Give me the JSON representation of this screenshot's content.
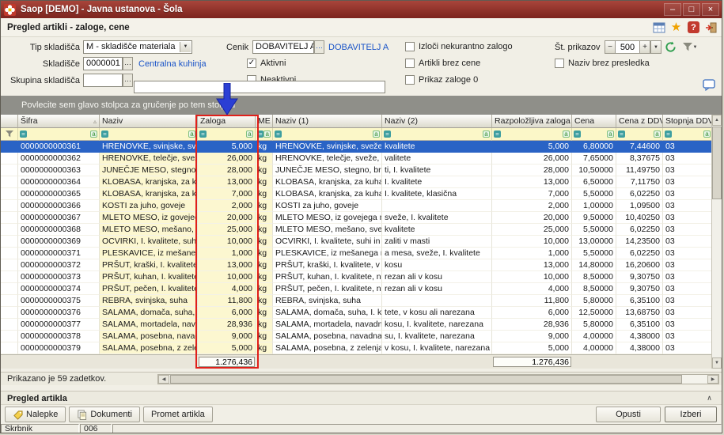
{
  "title_bar": {
    "title": "Saop  [DEMO] - Javna ustanova - Šola"
  },
  "icons": {
    "minimize": "–",
    "maximize": "□",
    "close": "×",
    "star": "★",
    "help": "?",
    "sort_asc": "▵",
    "check": "✓",
    "up": "▲",
    "down": "▼",
    "left": "◀",
    "right": "▶",
    "collapse": "∧",
    "caret": "▼",
    "minus": "−",
    "plus": "+",
    "ellipsis": "…"
  },
  "caption": {
    "form_title": "Pregled artikli - zaloge, cene"
  },
  "filters": {
    "tip_skladisca_label": "Tip skladišča",
    "tip_skladisca_value": "M - skladišče materiala",
    "cenik_label": "Cenik",
    "cenik_value": "DOBAVITELJ A",
    "cenik_link": "DOBAVITELJ A",
    "skladisce_label": "Skladišče",
    "skladisce_value": "0000001",
    "skladisce_link": "Centralna kuhinja",
    "skupina_label": "Skupina skladišča",
    "skupina_value": "",
    "quick_search_value": "",
    "aktivni": {
      "label": "Aktivni",
      "checked": true
    },
    "neaktivni": {
      "label": "Neaktivni",
      "checked": false
    },
    "izloci": {
      "label": "Izloči nekurantno zalogo",
      "checked": false
    },
    "artikli_brez_cene": {
      "label": "Artikli brez cene",
      "checked": false
    },
    "prikaz_zaloge": {
      "label": "Prikaz zaloge 0",
      "checked": false
    },
    "naziv_brez_presledka": {
      "label": "Naziv brez presledka",
      "checked": false
    },
    "st_prikazov_label": "Št. prikazov",
    "st_prikazov_value": "500"
  },
  "grid": {
    "group_hint": "Povlecite sem glavo stolpca za gručenje po tem stolpcu",
    "columns": [
      {
        "key": "sifra",
        "label": "Šifra",
        "sorted": true
      },
      {
        "key": "naziv",
        "label": "Naziv"
      },
      {
        "key": "zaloga",
        "label": "Zaloga"
      },
      {
        "key": "me",
        "label": "ME"
      },
      {
        "key": "naziv1",
        "label": "Naziv (1)"
      },
      {
        "key": "naziv2",
        "label": "Naziv (2)"
      },
      {
        "key": "razpolozljiva",
        "label": "Razpoložljiva zaloga"
      },
      {
        "key": "cena",
        "label": "Cena"
      },
      {
        "key": "cena_ddv",
        "label": "Cena z DDV"
      },
      {
        "key": "stopnja",
        "label": "Stopnja DDV"
      }
    ],
    "selected_index": 0,
    "rows": [
      [
        "0000000000361",
        "HRENOVKE, svinjske, sveže, I.",
        "5,000",
        "kg",
        "HRENOVKE, svinjske, sveže, I.",
        "kvalitete",
        "5,000",
        "6,80000",
        "7,44600",
        "03"
      ],
      [
        "0000000000362",
        "HRENOVKE, telečje, sveže, I. k",
        "26,000",
        "kg",
        "HRENOVKE, telečje, sveže, I. k",
        "valitete",
        "26,000",
        "7,65000",
        "8,37675",
        "03"
      ],
      [
        "0000000000363",
        "JUNEČJE MESO, stegno, brez kos ti,",
        "28,000",
        "kg",
        "JUNEČJE MESO, stegno, brez kos",
        "ti, I. kvalitete",
        "28,000",
        "10,50000",
        "11,49750",
        "03"
      ],
      [
        "0000000000364",
        "KLOBASA, kranjska, za kuhanje, I.",
        "13,000",
        "kg",
        "KLOBASA, kranjska, za kuhanje,",
        "I. kvalitete",
        "13,000",
        "6,50000",
        "7,11750",
        "03"
      ],
      [
        "0000000000365",
        "KLOBASA, kranjska, za kuhanje, I.",
        "7,000",
        "kg",
        "KLOBASA, kranjska, za kuhanje,",
        "I. kvalitete, klasična",
        "7,000",
        "5,50000",
        "6,02250",
        "03"
      ],
      [
        "0000000000366",
        "KOSTI za juho, goveje",
        "2,000",
        "kg",
        "KOSTI za juho, goveje",
        "",
        "2,000",
        "1,00000",
        "1,09500",
        "03"
      ],
      [
        "0000000000367",
        "MLETO MESO, iz govejega mesa,",
        "20,000",
        "kg",
        "MLETO MESO, iz govejega mesa,",
        "sveže, I. kvalitete",
        "20,000",
        "9,50000",
        "10,40250",
        "03"
      ],
      [
        "0000000000368",
        "MLETO MESO, mešano, sveže, I.",
        "25,000",
        "kg",
        "MLETO MESO, mešano, sveže, I.",
        "kvalitete",
        "25,000",
        "5,50000",
        "6,02250",
        "03"
      ],
      [
        "0000000000369",
        "OCVIRKI, I. kvalitete, suhi in zaliti v",
        "10,000",
        "kg",
        "OCVIRKI, I. kvalitete, suhi in",
        "zaliti v masti",
        "10,000",
        "13,00000",
        "14,23500",
        "03"
      ],
      [
        "0000000000371",
        "PLESKAVICE, iz mešanega mleteg a",
        "1,000",
        "kg",
        "PLESKAVICE, iz mešanega mleteg",
        "a mesa, sveže, I. kvalitete",
        "1,000",
        "5,50000",
        "6,02250",
        "03"
      ],
      [
        "0000000000372",
        "PRŠUT, kraški, I. kvalitete, v kosu",
        "13,000",
        "kg",
        "PRŠUT, kraški, I. kvalitete, v",
        "kosu",
        "13,000",
        "14,80000",
        "16,20600",
        "03"
      ],
      [
        "0000000000373",
        "PRŠUT, kuhan, I. kvalitete, na rezan",
        "10,000",
        "kg",
        "PRŠUT, kuhan, I. kvalitete, na",
        "rezan ali v kosu",
        "10,000",
        "8,50000",
        "9,30750",
        "03"
      ],
      [
        "0000000000374",
        "PRŠUT, pečen, I. kvalitete, na rezan",
        "4,000",
        "kg",
        "PRŠUT, pečen, I. kvalitete, na",
        "rezan ali v kosu",
        "4,000",
        "8,50000",
        "9,30750",
        "03"
      ],
      [
        "0000000000375",
        "REBRA, svinjska, suha",
        "11,800",
        "kg",
        "REBRA, svinjska, suha",
        "",
        "11,800",
        "5,80000",
        "6,35100",
        "03"
      ],
      [
        "0000000000376",
        "SALAMA, domača, suha, I. kvali",
        "6,000",
        "kg",
        "SALAMA, domača, suha, I. kvali",
        "tete, v kosu ali narezana",
        "6,000",
        "12,50000",
        "13,68750",
        "03"
      ],
      [
        "0000000000377",
        "SALAMA, mortadela, navadna, v",
        "28,936",
        "kg",
        "SALAMA, mortadela, navadna, v",
        "kosu, I. kvalitete, narezana",
        "28,936",
        "5,80000",
        "6,35100",
        "03"
      ],
      [
        "0000000000378",
        "SALAMA, posebna, navadna, v ko",
        "9,000",
        "kg",
        "SALAMA, posebna, navadna, v ko",
        "su, I. kvalitete, narezana",
        "9,000",
        "4,00000",
        "4,38000",
        "03"
      ],
      [
        "0000000000379",
        "SALAMA, posebna, z zelenjavo,",
        "5,000",
        "kg",
        "SALAMA, posebna, z zelenjavo,",
        "v kosu, I. kvalitete, narezana",
        "5,000",
        "4,00000",
        "4,38000",
        "03"
      ]
    ],
    "totals": {
      "zaloga": "1.276,436",
      "razpolozljiva": "1.276,436"
    }
  },
  "status_row": {
    "text": "Prikazano je 59 zadetkov."
  },
  "detail": {
    "section_title": "Pregled artikla",
    "nalepke": "Nalepke",
    "dokumenti": "Dokumenti",
    "promet": "Promet artikla",
    "opusti": "Opusti",
    "izberi": "Izberi"
  },
  "statusbar": {
    "user": "Skrbnik",
    "code": "006"
  }
}
